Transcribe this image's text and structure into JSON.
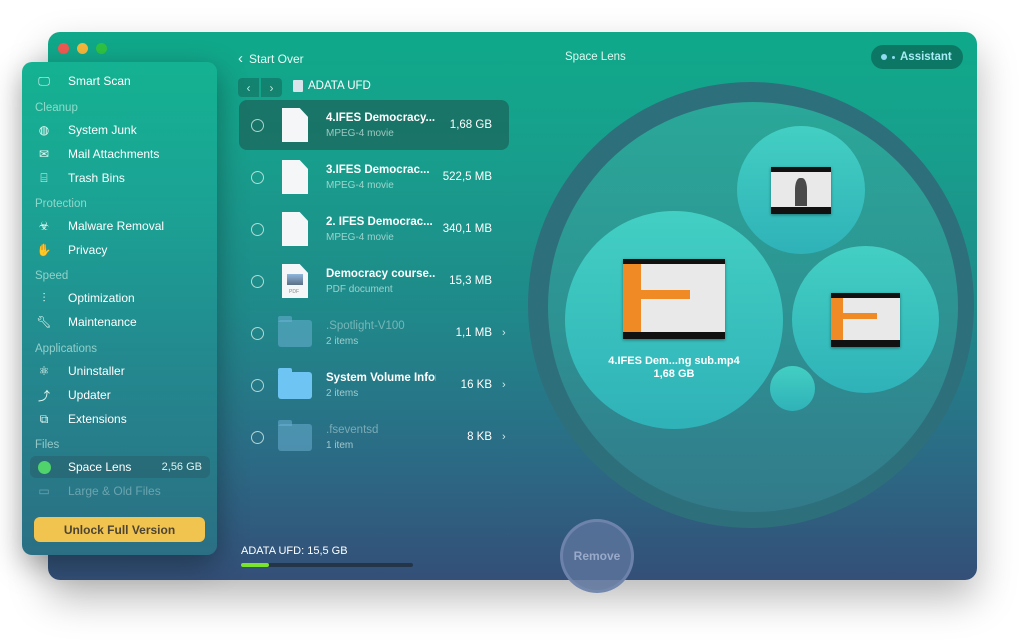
{
  "window": {
    "title": "Space Lens",
    "traffic_lights": [
      "close",
      "minimize",
      "zoom"
    ]
  },
  "header": {
    "back_label": "Start Over",
    "back_icon": "chevron-left-icon",
    "title": "Space Lens",
    "assistant_label": "Assistant"
  },
  "sidebar": {
    "smart_scan": "Smart Scan",
    "sections": {
      "cleanup": "Cleanup",
      "protection": "Protection",
      "speed": "Speed",
      "applications": "Applications",
      "files": "Files"
    },
    "items": {
      "system_junk": "System Junk",
      "mail_attachments": "Mail Attachments",
      "trash_bins": "Trash Bins",
      "malware_removal": "Malware Removal",
      "privacy": "Privacy",
      "optimization": "Optimization",
      "maintenance": "Maintenance",
      "uninstaller": "Uninstaller",
      "updater": "Updater",
      "extensions": "Extensions",
      "space_lens": "Space Lens",
      "space_lens_size": "2,56 GB",
      "large_old_files": "Large & Old Files"
    },
    "unlock_label": "Unlock Full Version"
  },
  "browser": {
    "nav_back": "‹",
    "nav_forward": "›",
    "location": "ADATA UFD",
    "files": [
      {
        "name": "4.IFES Democracy...",
        "kind": "MPEG-4 movie",
        "size": "1,68 GB",
        "type": "doc",
        "selected": true
      },
      {
        "name": "3.IFES Democrac...",
        "kind": "MPEG-4 movie",
        "size": "522,5 MB",
        "type": "doc"
      },
      {
        "name": "2. IFES Democrac...",
        "kind": "MPEG-4 movie",
        "size": "340,1 MB",
        "type": "doc"
      },
      {
        "name": "Democracy course...",
        "kind": "PDF document",
        "size": "15,3 MB",
        "type": "pdf",
        "pdf_label": "PDF"
      },
      {
        "name": ".Spotlight-V100",
        "kind": "2 items",
        "size": "1,1 MB",
        "type": "folder-dim",
        "chevron": "›"
      },
      {
        "name": "System Volume Infor...",
        "kind": "2 items",
        "size": "16 KB",
        "type": "folder",
        "chevron": "›"
      },
      {
        "name": ".fseventsd",
        "kind": "1 item",
        "size": "8 KB",
        "type": "folder-dim",
        "chevron": "›"
      }
    ]
  },
  "storage": {
    "label": "ADATA UFD: 15,5 GB",
    "used_fraction": 0.16,
    "bar_color": "#7ae32b"
  },
  "remove_label": "Remove",
  "lens": {
    "selected_name": "4.IFES Dem...ng sub.mp4",
    "selected_size": "1,68 GB"
  },
  "colors": {
    "accent_unlock": "#f1c44f",
    "window_top": "#0fa98a",
    "window_bottom": "#344f78"
  }
}
